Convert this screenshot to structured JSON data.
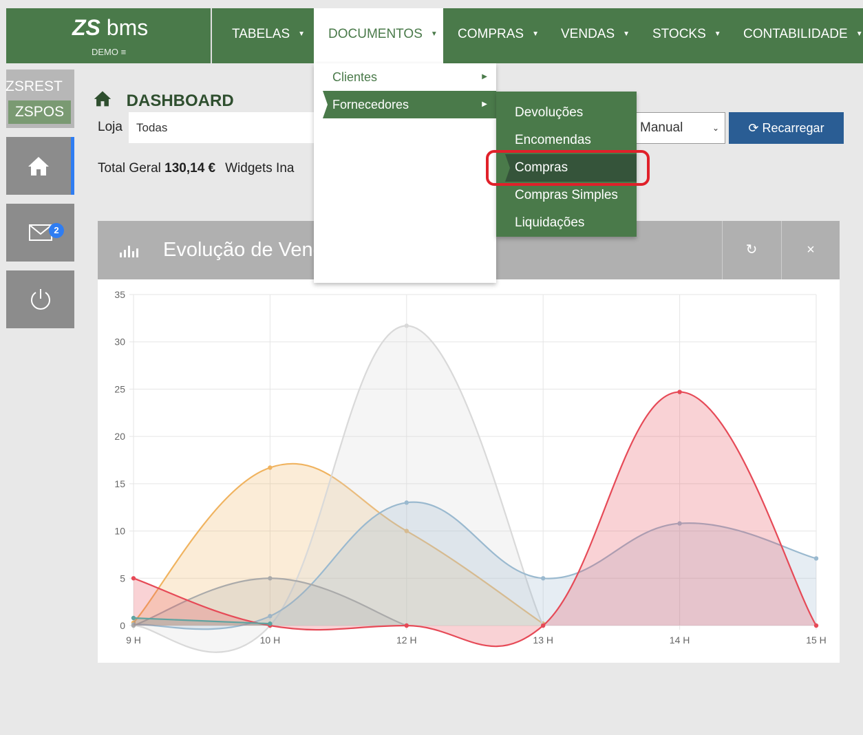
{
  "app": {
    "logo_prefix": "ZS",
    "logo_name": "bms",
    "edition": "DEMO"
  },
  "nav": [
    {
      "label": "TABELAS"
    },
    {
      "label": "DOCUMENTOS"
    },
    {
      "label": "COMPRAS"
    },
    {
      "label": "VENDAS"
    },
    {
      "label": "STOCKS"
    },
    {
      "label": "CONTABILIDADE"
    }
  ],
  "sidebar": {
    "zsrest": "ZSREST",
    "zspos": "ZSPOS",
    "mail_badge": "2"
  },
  "dashboard": {
    "title": "DASHBOARD",
    "loja_label": "Loja",
    "loja_value": "Todas",
    "refresh_mode": "Manual",
    "reload_label": "Recarregar",
    "total_label": "Total Geral",
    "total_value": "130,14 €",
    "widgets_label": "Widgets Ina"
  },
  "widget": {
    "title": "Evolução de Vend",
    "refresh_icon": "refresh-icon",
    "close_label": "×"
  },
  "documentos_menu": [
    {
      "label": "Clientes"
    },
    {
      "label": "Fornecedores"
    }
  ],
  "fornecedores_menu": [
    {
      "label": "Devoluções"
    },
    {
      "label": "Encomendas"
    },
    {
      "label": "Compras"
    },
    {
      "label": "Compras Simples"
    },
    {
      "label": "Liquidações"
    }
  ],
  "colors": {
    "brand_green": "#4a7a4a",
    "reload_blue": "#2a5d94",
    "highlight_red": "#e0212a"
  },
  "chart_data": {
    "type": "area",
    "categories": [
      "9 H",
      "10 H",
      "12 H",
      "13 H",
      "14 H",
      "15 H"
    ],
    "ylim": [
      0,
      35
    ],
    "yticks": [
      0,
      5,
      10,
      15,
      20,
      25,
      30,
      35
    ],
    "grid": true,
    "series": [
      {
        "color": "#f0b35f",
        "values": [
          0.3,
          16.7,
          10,
          0.2,
          null,
          null
        ]
      },
      {
        "color": "#d9d9d9",
        "values": [
          0,
          0,
          31.7,
          0,
          null,
          null
        ]
      },
      {
        "color": "#9ab9cf",
        "values": [
          0.1,
          1,
          13,
          5,
          10.8,
          7.1
        ]
      },
      {
        "color": "#aaaaaa",
        "values": [
          0,
          5,
          0,
          null,
          null,
          null
        ]
      },
      {
        "color": "#e64a57",
        "values": [
          5,
          0,
          0,
          0,
          24.7,
          0
        ]
      },
      {
        "color": "#5fa3a0",
        "values": [
          0.8,
          0.2,
          null,
          null,
          null,
          null
        ]
      }
    ]
  }
}
